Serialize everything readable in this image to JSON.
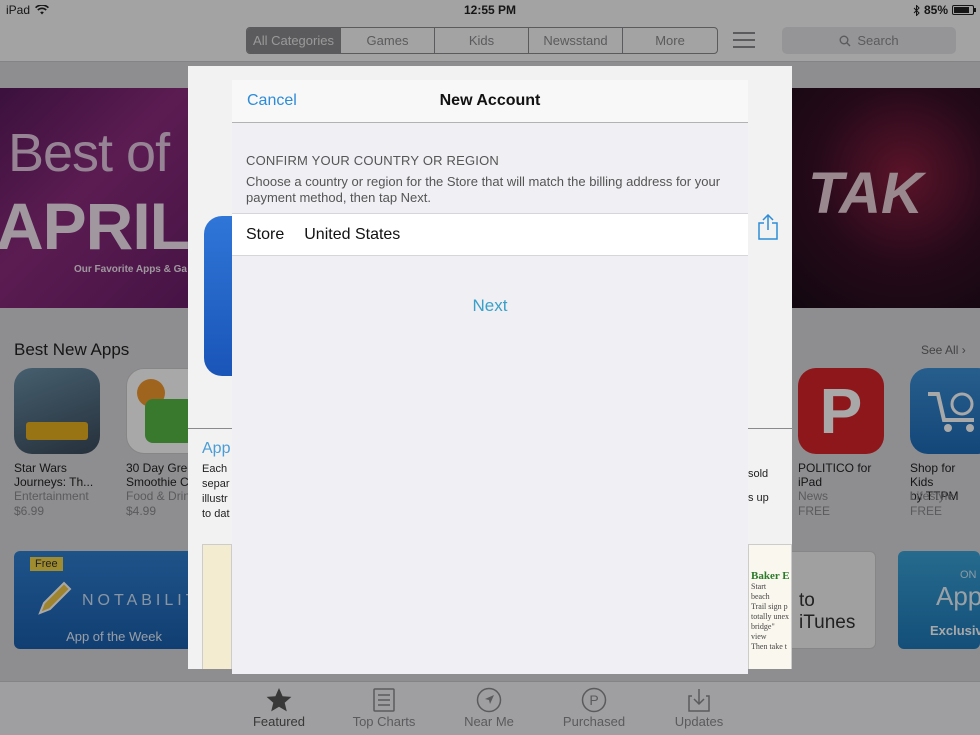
{
  "status": {
    "device": "iPad",
    "time": "12:55 PM",
    "battery": "85%",
    "battery_level": 0.85
  },
  "appstore": {
    "categories": [
      {
        "label": "All Categories",
        "active": true
      },
      {
        "label": "Games"
      },
      {
        "label": "Kids"
      },
      {
        "label": "Newsstand"
      },
      {
        "label": "More"
      }
    ],
    "search_placeholder": "Search",
    "banner_left": {
      "line1": "Best of",
      "line2": "APRIL",
      "line3": "Our Favorite Apps & Ga"
    },
    "banner_right": {
      "text": "TAK"
    },
    "section_title": "Best New Apps",
    "see_all": "See All",
    "apps": [
      {
        "name_line1": "Star Wars",
        "name_line2": "Journeys: Th...",
        "category": "Entertainment",
        "price": "$6.99"
      },
      {
        "name_line1": "30 Day Gree",
        "name_line2": "Smoothie C",
        "category": "Food & Drin",
        "price": "$4.99"
      },
      {
        "name_line1": "POLITICO for",
        "name_line2": "iPad",
        "category": "News",
        "price": "FREE"
      },
      {
        "name_line1": "Shop for Kids",
        "name_line2": "by TTPM",
        "category": "Lifestyle",
        "price": "FREE"
      }
    ],
    "promo_free_badge": "Free",
    "promo_notability": "NOTABILIT",
    "promo_app_of_week": "App of the Week",
    "promo_itunes": "to iTunes",
    "promo_app_label": "App",
    "promo_exclusive": "Exclusive",
    "promo_on_label": "ON",
    "tabs": [
      {
        "label": "Featured",
        "active": true
      },
      {
        "label": "Top Charts"
      },
      {
        "label": "Near Me"
      },
      {
        "label": "Purchased"
      },
      {
        "label": "Updates"
      }
    ]
  },
  "backsheet": {
    "link": "App",
    "desc_lines": [
      "Each",
      "separ",
      "illustr",
      "to dat"
    ],
    "right_lines": [
      "sold",
      "s up"
    ],
    "shot_title": "Baker E",
    "shot_lines": [
      "Start",
      "beach",
      "Trail sign p",
      "totally unex",
      "bridge\" view",
      "Then take t"
    ]
  },
  "sheet": {
    "cancel": "Cancel",
    "title": "New Account",
    "heading": "CONFIRM YOUR COUNTRY OR REGION",
    "explain": "Choose a country or region for the Store that will match the billing address for your payment method, then tap Next.",
    "store_label": "Store",
    "store_value": "United States",
    "next": "Next"
  },
  "colors": {
    "accent_blue": "#2d8cd8",
    "next_blue": "#3aa0c8"
  }
}
